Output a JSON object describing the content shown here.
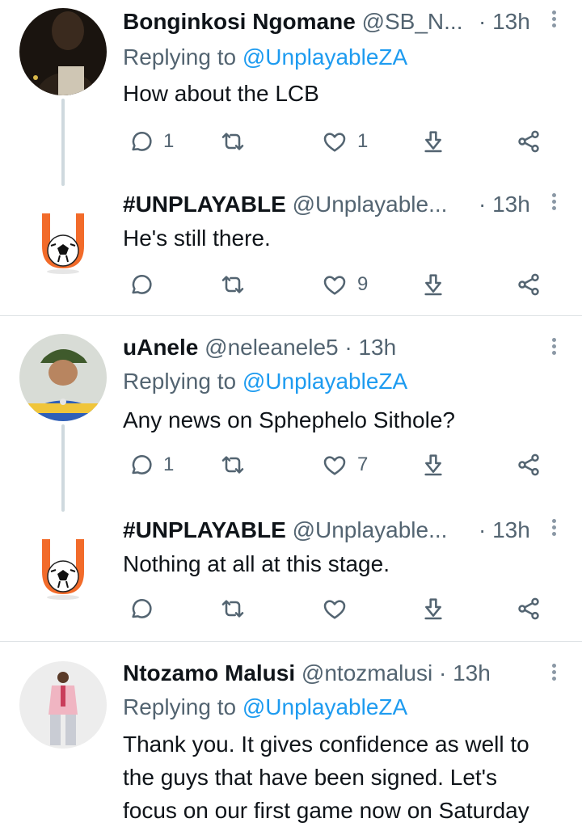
{
  "tweets": [
    {
      "name": "Bonginkosi Ngomane",
      "handle": "@SB_N...",
      "time": "13h",
      "replying_prefix": "Replying to",
      "replying_handle": "@UnplayableZA",
      "text": "How about the LCB",
      "reply_count": "1",
      "retweet_count": "",
      "like_count": "1"
    },
    {
      "name": "#UNPLAYABLE",
      "handle": "@Unplayable...",
      "time": "13h",
      "text": "He's still there.",
      "reply_count": "",
      "retweet_count": "",
      "like_count": "9"
    },
    {
      "name": "uAnele",
      "handle": "@neleanele5",
      "time": "13h",
      "replying_prefix": "Replying to",
      "replying_handle": "@UnplayableZA",
      "text": "Any news on Sphephelo Sithole?",
      "reply_count": "1",
      "retweet_count": "",
      "like_count": "7"
    },
    {
      "name": "#UNPLAYABLE",
      "handle": "@Unplayable...",
      "time": "13h",
      "text": "Nothing at all at this stage.",
      "reply_count": "",
      "retweet_count": "",
      "like_count": ""
    },
    {
      "name": "Ntozamo Malusi",
      "handle": "@ntozmalusi",
      "time": "13h",
      "replying_prefix": "Replying to",
      "replying_handle": "@UnplayableZA",
      "text_lines": [
        "Thank you. It gives confidence as well to",
        "the guys that have been signed. Let's",
        "focus on our first game now on Saturday"
      ]
    }
  ],
  "meta_dot": "·",
  "colors": {
    "link": "#1d9bf0",
    "secondary": "#536471",
    "brand_orange": "#f26b2a"
  },
  "icons": [
    "reply-icon",
    "retweet-icon",
    "like-icon",
    "bookmark-download-icon",
    "share-icon",
    "more-icon"
  ]
}
